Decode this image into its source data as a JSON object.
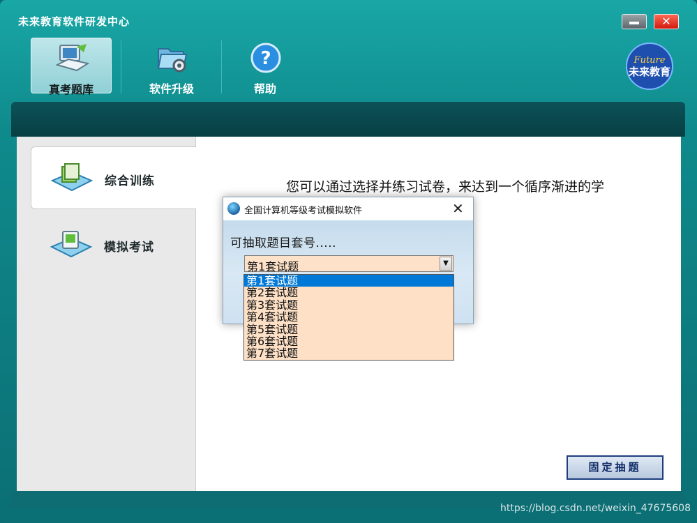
{
  "window": {
    "title": "未来教育软件研发中心"
  },
  "toolbar": {
    "items": [
      {
        "label": "真考题库",
        "icon": "computer-icon"
      },
      {
        "label": "软件升级",
        "icon": "folder-gear-icon"
      },
      {
        "label": "帮助",
        "icon": "help-icon"
      }
    ]
  },
  "logo": {
    "brand_en": "Future",
    "brand_cn": "未来教育"
  },
  "sidebar": {
    "items": [
      {
        "label": "综合训练"
      },
      {
        "label": "模拟考试"
      }
    ]
  },
  "main": {
    "intro_text": "您可以通过选择并练习试卷，来达到一个循序渐进的学",
    "fixed_button": "固定抽题"
  },
  "dialog": {
    "title": "全国计算机等级考试模拟软件",
    "message": "可抽取题目套号.....",
    "selected": "第1套试题",
    "options": [
      "第1套试题",
      "第2套试题",
      "第3套试题",
      "第4套试题",
      "第5套试题",
      "第6套试题",
      "第7套试题"
    ]
  },
  "watermark": "https://blog.csdn.net/weixin_47675608"
}
